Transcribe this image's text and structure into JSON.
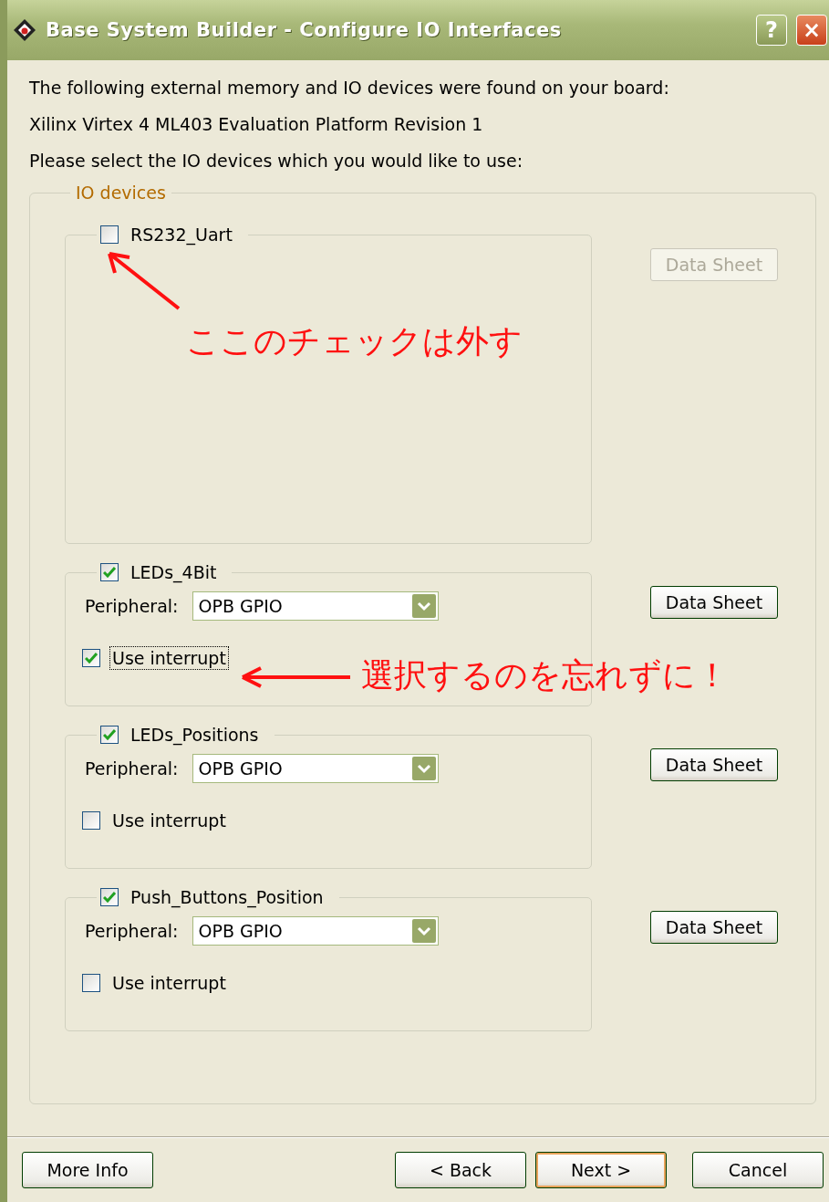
{
  "window": {
    "title": "Base System Builder - Configure IO Interfaces",
    "help_button": "?",
    "close_button": "×"
  },
  "intro": [
    "The following external memory and IO devices were found on your board:",
    "Xilinx Virtex 4 ML403 Evaluation Platform Revision 1",
    "Please select the IO devices which you would like to use:"
  ],
  "io_devices": {
    "legend": "IO devices",
    "devices": [
      {
        "name": "RS232_Uart",
        "checked": false,
        "data_sheet": {
          "label": "Data Sheet",
          "disabled": true
        }
      },
      {
        "name": "LEDs_4Bit",
        "checked": true,
        "data_sheet": {
          "label": "Data Sheet",
          "disabled": false
        },
        "peripheral": {
          "label": "Peripheral:",
          "value": "OPB GPIO"
        },
        "interrupt": {
          "label": "Use interrupt",
          "checked": true,
          "focused": true
        }
      },
      {
        "name": "LEDs_Positions",
        "checked": true,
        "data_sheet": {
          "label": "Data Sheet",
          "disabled": false
        },
        "peripheral": {
          "label": "Peripheral:",
          "value": "OPB GPIO"
        },
        "interrupt": {
          "label": "Use interrupt",
          "checked": false,
          "focused": false
        }
      },
      {
        "name": "Push_Buttons_Position",
        "checked": true,
        "data_sheet": {
          "label": "Data Sheet",
          "disabled": false
        },
        "peripheral": {
          "label": "Peripheral:",
          "value": "OPB GPIO"
        },
        "interrupt": {
          "label": "Use interrupt",
          "checked": false,
          "focused": false
        }
      }
    ]
  },
  "annotations": [
    {
      "text": "ここのチェックは外す",
      "kind": "diagonal"
    },
    {
      "text": "選択するのを忘れずに！",
      "kind": "left"
    }
  ],
  "buttons": [
    {
      "label": "More Info",
      "default": false
    },
    {
      "label": "< Back",
      "default": false
    },
    {
      "label": "Next >",
      "default": true
    },
    {
      "label": "Cancel",
      "default": false
    }
  ]
}
